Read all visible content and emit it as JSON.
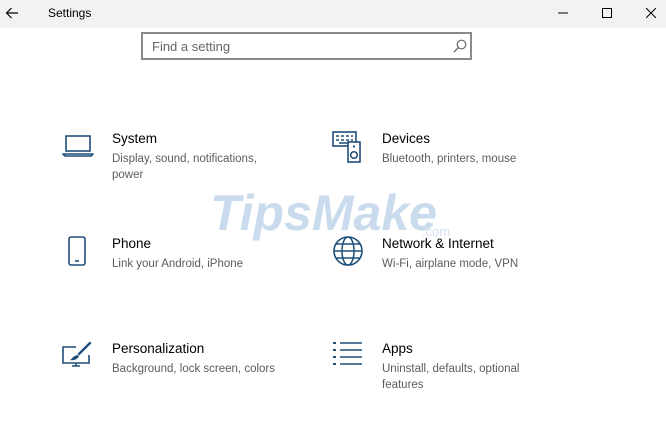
{
  "window": {
    "title": "Settings",
    "controls": {
      "back_icon": "arrow-left-icon",
      "minimize_icon": "minimize-icon",
      "maximize_icon": "maximize-icon",
      "close_icon": "close-icon"
    }
  },
  "search": {
    "placeholder": "Find a setting",
    "value": "",
    "icon": "search-icon"
  },
  "categories": [
    {
      "title": "System",
      "description": "Display, sound, notifications, power",
      "icon": "laptop-icon"
    },
    {
      "title": "Devices",
      "description": "Bluetooth, printers, mouse",
      "icon": "devices-icon"
    },
    {
      "title": "Phone",
      "description": "Link your Android, iPhone",
      "icon": "phone-icon"
    },
    {
      "title": "Network & Internet",
      "description": "Wi-Fi, airplane mode, VPN",
      "icon": "globe-icon"
    },
    {
      "title": "Personalization",
      "description": "Background, lock screen, colors",
      "icon": "paintbrush-icon"
    },
    {
      "title": "Apps",
      "description": "Uninstall, defaults, optional features",
      "icon": "apps-list-icon"
    }
  ],
  "watermark": {
    "brand": "TipsMake",
    "suffix": ".com"
  },
  "colors": {
    "accent": "#1f4e79",
    "titlebar_bg": "#f2f2f2",
    "description_text": "#5c5c5c",
    "watermark": "#b8cfe8"
  }
}
